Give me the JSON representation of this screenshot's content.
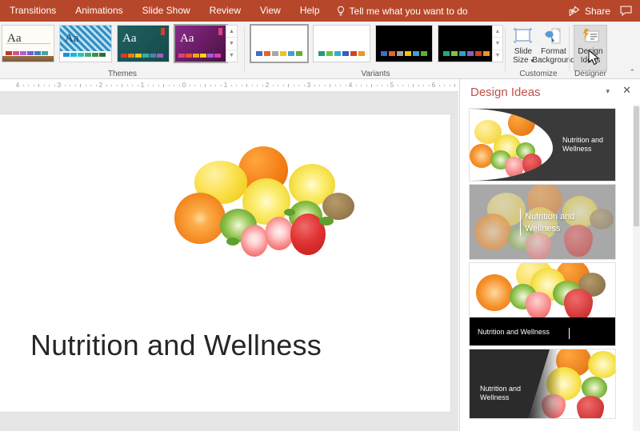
{
  "ribbon": {
    "tabs": [
      {
        "label": "Transitions"
      },
      {
        "label": "Animations"
      },
      {
        "label": "Slide Show"
      },
      {
        "label": "Review"
      },
      {
        "label": "View"
      },
      {
        "label": "Help"
      }
    ],
    "tell_me": "Tell me what you want to do",
    "share_label": "Share",
    "accent_color": "#b7472a",
    "groups": {
      "themes_label": "Themes",
      "variants_label": "Variants",
      "customize_label": "Customize",
      "designer_label": "Designer"
    },
    "customize": {
      "slide_size_line1": "Slide",
      "slide_size_line2": "Size",
      "format_bg_line1": "Format",
      "format_bg_line2": "Background"
    },
    "designer": {
      "design_ideas_line1": "Design",
      "design_ideas_line2": "Ideas"
    },
    "themes": [
      {
        "name": "theme-wood",
        "aa": "Aa",
        "bg": "#fdfcf7",
        "text": "#3b3b3b",
        "swatches": [
          "#c0392b",
          "#d94f8c",
          "#b05fd6",
          "#7a5cc4",
          "#3f7fbf",
          "#4ea3a0"
        ],
        "selected": false
      },
      {
        "name": "theme-berlin-pattern",
        "aa": "Aa",
        "bg": "#ffffff",
        "text": "#15486b",
        "swatches": [
          "#1f8fd4",
          "#1bb5d8",
          "#2fc3b8",
          "#3faf6f",
          "#3f8f4a",
          "#2f6f3a"
        ],
        "selected": false
      },
      {
        "name": "theme-teal",
        "aa": "Aa",
        "bg": "#1f5a5a",
        "text": "#ffffff",
        "swatches": [
          "#d43f2a",
          "#e8801f",
          "#f0c419",
          "#3fae9a",
          "#4a7fb5",
          "#a05fc4"
        ],
        "selected": false
      },
      {
        "name": "theme-purple",
        "aa": "Aa",
        "bg": "#6b1f6b",
        "text": "#ffffff",
        "swatches": [
          "#e0407f",
          "#e8562f",
          "#f0a41c",
          "#f0d41c",
          "#9a5fd6",
          "#d63fb5"
        ],
        "selected": true
      }
    ],
    "variants": [
      {
        "name": "variant-white-1",
        "bg": "#ffffff",
        "swatches": [
          "#3f6fc4",
          "#e8622a",
          "#a6a6a6",
          "#f0c21c",
          "#3f9fd4",
          "#5fb02f"
        ],
        "selected": true
      },
      {
        "name": "variant-white-2",
        "bg": "#ffffff",
        "swatches": [
          "#1f9a7a",
          "#6fbf3f",
          "#2fafd4",
          "#2a62c4",
          "#d4421f",
          "#f0941c"
        ],
        "selected": false
      },
      {
        "name": "variant-black-1",
        "bg": "#000000",
        "swatches": [
          "#3f6fc4",
          "#e8622a",
          "#a6a6a6",
          "#f0c21c",
          "#3f9fd4",
          "#5fb02f"
        ],
        "selected": false
      },
      {
        "name": "variant-black-2",
        "bg": "#000000",
        "swatches": [
          "#1fa88a",
          "#7fc43f",
          "#2f9fd4",
          "#8a5fc4",
          "#d4421f",
          "#f0941c"
        ],
        "selected": false
      }
    ]
  },
  "ruler": {
    "ticks": [
      "4",
      "3",
      "2",
      "1",
      "0",
      "1",
      "2",
      "3",
      "4",
      "5",
      "6"
    ]
  },
  "slide": {
    "title": "Nutrition and Wellness",
    "image_alt": "fruit-photo"
  },
  "design_panel": {
    "title": "Design Ideas",
    "caret_icon": "chevron-down-icon",
    "close_icon": "close-icon",
    "ideas": [
      {
        "name": "idea-curved-left-image",
        "text": "Nutrition and\nWellness",
        "layout": "image-left-curve",
        "panel_color": "#3a3a3a"
      },
      {
        "name": "idea-full-bleed-faded",
        "text": "Nutrition and\nWellness",
        "layout": "full-image-overlay",
        "panel_color": "#8e8e8e"
      },
      {
        "name": "idea-image-top-bar-bottom",
        "text": "Nutrition and Wellness",
        "layout": "image-top-bar-bottom",
        "panel_color": "#000000"
      },
      {
        "name": "idea-diagonal-right-image",
        "text": "Nutrition and\nWellness",
        "layout": "image-right-diagonal",
        "panel_color": "#2b2b2b"
      }
    ]
  }
}
